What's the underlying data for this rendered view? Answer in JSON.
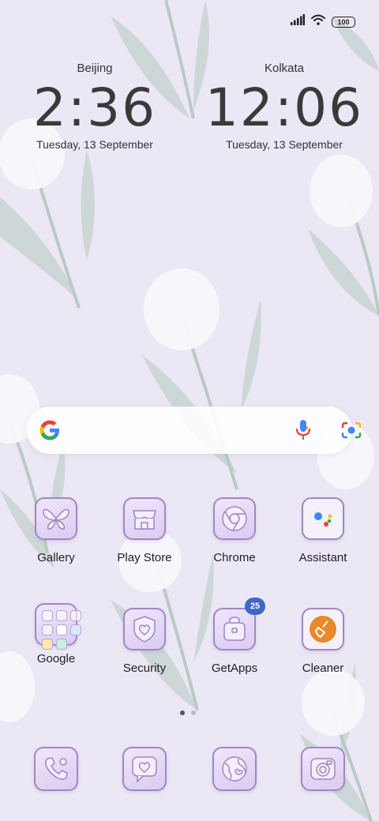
{
  "status_bar": {
    "battery": "100",
    "icons": [
      "signal-icon",
      "wifi-icon",
      "battery-icon"
    ]
  },
  "clocks": [
    {
      "city": "Beijing",
      "time": "2:36",
      "date": "Tuesday, 13 September"
    },
    {
      "city": "Kolkata",
      "time": "12:06",
      "date": "Tuesday, 13 September"
    }
  ],
  "search": {
    "icons": [
      "google-logo-icon",
      "microphone-icon",
      "google-lens-icon"
    ]
  },
  "apps_row1": [
    {
      "label": "Gallery",
      "icon": "butterfly-icon"
    },
    {
      "label": "Play Store",
      "icon": "store-icon"
    },
    {
      "label": "Chrome",
      "icon": "chrome-icon"
    },
    {
      "label": "Assistant",
      "icon": "assistant-icon"
    }
  ],
  "apps_row2": [
    {
      "label": "Google",
      "icon": "folder-icon"
    },
    {
      "label": "Security",
      "icon": "shield-heart-icon"
    },
    {
      "label": "GetApps",
      "icon": "bag-icon",
      "badge": "25"
    },
    {
      "label": "Cleaner",
      "icon": "broom-icon"
    }
  ],
  "dock": [
    {
      "icon": "phone-icon"
    },
    {
      "icon": "message-heart-icon"
    },
    {
      "icon": "browser-globe-icon"
    },
    {
      "icon": "camera-icon"
    }
  ],
  "page_indicator": {
    "pages": 2,
    "current": 1
  },
  "colors": {
    "background": "#ebe7f4",
    "icon_border": "#9f88c4",
    "badge": "#3f67c6",
    "cleaner_orange": "#e8892a"
  }
}
